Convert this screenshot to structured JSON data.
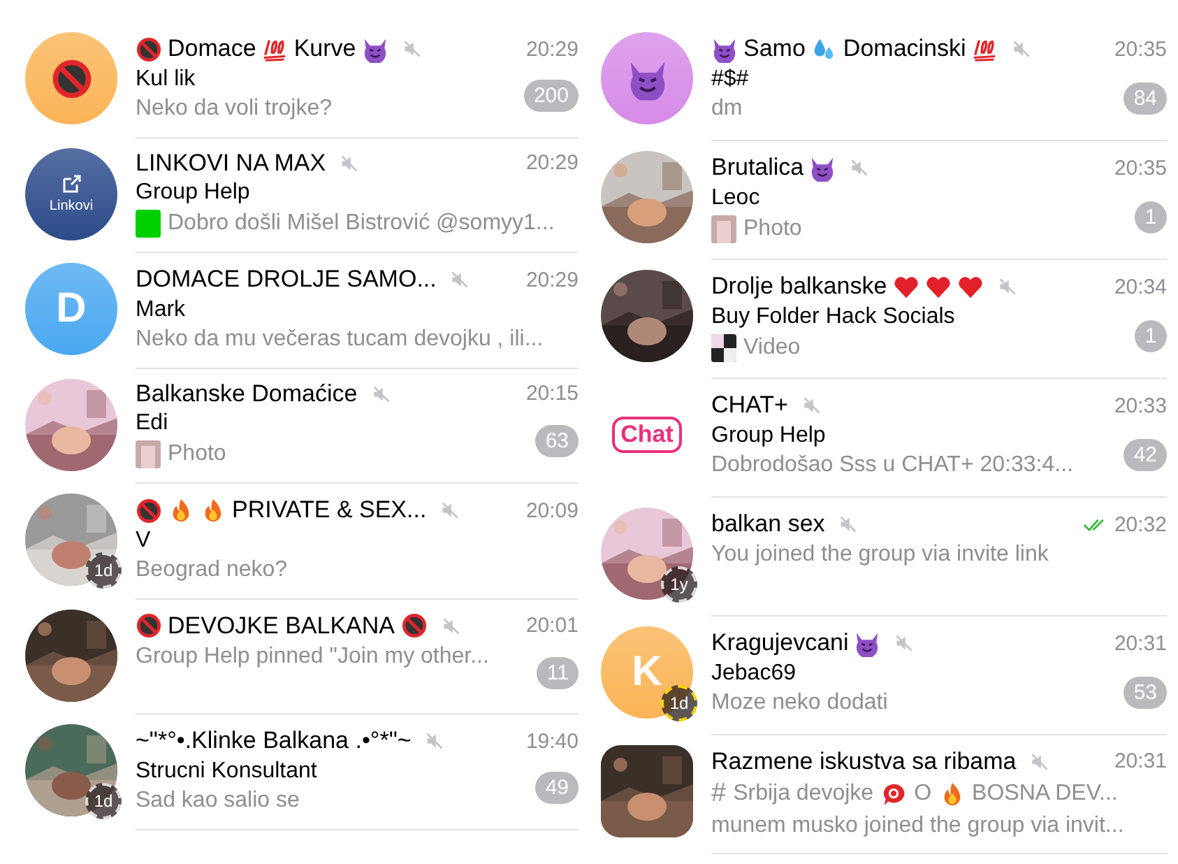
{
  "columns": [
    {
      "chats": [
        {
          "title": [
            {
              "kind": "no18"
            },
            {
              "kind": "text",
              "text": "Domace"
            },
            {
              "kind": "hundred"
            },
            {
              "kind": "text",
              "text": "Kurve"
            },
            {
              "kind": "devil"
            }
          ],
          "muted": true,
          "time": "20:29",
          "sender": "Kul lik",
          "preview": {
            "kind": "text",
            "text": "Neko da voli trojke?"
          },
          "unread": "200",
          "avatar": {
            "kind": "no18",
            "color": "#fbb456"
          }
        },
        {
          "title": [
            {
              "kind": "text",
              "text": "LINKOVI NA MAX"
            }
          ],
          "muted": true,
          "time": "20:29",
          "sender": "Group Help",
          "preview": {
            "kind": "square",
            "color": "#00d000",
            "text": "Dobro došli Mišel Bistrović @somyy1..."
          },
          "avatar": {
            "kind": "link",
            "label": "Linkovi"
          }
        },
        {
          "title": [
            {
              "kind": "text",
              "text": "DOMACE DROLJE SAMO..."
            }
          ],
          "muted": true,
          "time": "20:29",
          "sender": "Mark",
          "preview": {
            "kind": "text",
            "text": "Neko da mu večeras tucam devojku , ili..."
          },
          "avatar": {
            "kind": "letter",
            "letter": "D",
            "color": "#4aa8f0"
          }
        },
        {
          "title": [
            {
              "kind": "text",
              "text": "Balkanske Domaćice"
            }
          ],
          "muted": true,
          "time": "20:15",
          "sender": "Edi",
          "preview": {
            "text": "Photo"
          },
          "unread": "63",
          "avatar": {
            "kind": "picture"
          }
        },
        {
          "title": [
            {
              "kind": "no18"
            },
            {
              "kind": "fire"
            },
            {
              "kind": "fire"
            },
            {
              "kind": "text",
              "text": "PRIVATE & SEX..."
            }
          ],
          "muted": true,
          "time": "20:09",
          "sender": "V",
          "preview": {
            "kind": "text",
            "text": "Beograd neko?"
          },
          "avatar": {
            "kind": "picture"
          },
          "story": {
            "label": "1d",
            "color": "#d8d8d8"
          }
        },
        {
          "title": [
            {
              "kind": "no18"
            },
            {
              "kind": "text",
              "text": "DEVOJKE BALKANA"
            },
            {
              "kind": "no18"
            }
          ],
          "muted": true,
          "time": "20:01",
          "preview": {
            "kind": "text",
            "text": "Group Help pinned \"Join my other..."
          },
          "unread": "11",
          "avatar": {
            "kind": "picture"
          }
        },
        {
          "title": [
            {
              "kind": "text",
              "text": "~\"*°•.Klinke Balkana .•°*\"~"
            }
          ],
          "muted": true,
          "time": "19:40",
          "sender": "Strucni Konsultant",
          "preview": {
            "kind": "text",
            "text": "Sad kao salio se"
          },
          "unread": "49",
          "avatar": {
            "kind": "picture"
          },
          "story": {
            "label": "1d",
            "color": "#d8d8d8"
          }
        }
      ]
    },
    {
      "chats": [
        {
          "title": [
            {
              "kind": "devil"
            },
            {
              "kind": "text",
              "text": "Samo"
            },
            {
              "kind": "droplets"
            },
            {
              "kind": "text",
              "text": "Domacinski"
            },
            {
              "kind": "hundred"
            }
          ],
          "muted": true,
          "time": "20:35",
          "sender": "#$#",
          "preview": {
            "kind": "text",
            "text": "dm"
          },
          "unread": "84",
          "avatar": {
            "kind": "devil",
            "color": "#d68be8"
          }
        },
        {
          "title": [
            {
              "kind": "text",
              "text": "Brutalica"
            },
            {
              "kind": "devil"
            }
          ],
          "muted": true,
          "time": "20:35",
          "sender": "Leoc",
          "preview": {
            "text": "Photo"
          },
          "unread": "1",
          "avatar": {
            "kind": "picture"
          }
        },
        {
          "title": [
            {
              "kind": "text",
              "text": "Drolje balkanske"
            },
            {
              "kind": "heart"
            },
            {
              "kind": "heart"
            },
            {
              "kind": "heart"
            }
          ],
          "muted": true,
          "time": "20:34",
          "sender": "Buy Folder Hack Socials",
          "preview": {
            "kind": "video",
            "text": "Video"
          },
          "unread": "1",
          "avatar": {
            "kind": "picture"
          }
        },
        {
          "title": [
            {
              "kind": "text",
              "text": "CHAT+"
            }
          ],
          "muted": true,
          "time": "20:33",
          "sender": "Group Help",
          "preview": {
            "kind": "text",
            "text": "Dobrodošao Sss u CHAT+ 20:33:4..."
          },
          "unread": "42",
          "avatar": {
            "kind": "chat",
            "label": "Chat"
          }
        },
        {
          "title": [
            {
              "kind": "text",
              "text": "balkan sex"
            }
          ],
          "muted": true,
          "read": true,
          "time": "20:32",
          "preview": {
            "kind": "text",
            "text": "You joined the group via invite link"
          },
          "avatar": {
            "kind": "picture"
          },
          "story": {
            "label": "1y",
            "color": "#d8d8d8"
          }
        },
        {
          "title": [
            {
              "kind": "text",
              "text": "Kragujevcani"
            },
            {
              "kind": "devil"
            }
          ],
          "muted": true,
          "time": "20:31",
          "sender": "Jebac69",
          "preview": {
            "kind": "text",
            "text": "Moze neko dodati"
          },
          "unread": "53",
          "avatar": {
            "kind": "letter",
            "letter": "K",
            "color": "#fbb456"
          },
          "story": {
            "label": "1d",
            "color": "#f5d000"
          }
        },
        {
          "title": [
            {
              "kind": "text",
              "text": "Razmene iskustva sa ribama"
            }
          ],
          "muted": true,
          "time": "20:31",
          "topic": [
            {
              "kind": "hash",
              "text": "#"
            },
            {
              "kind": "text",
              "text": "Srbija devojke"
            },
            {
              "kind": "bubble"
            },
            {
              "kind": "text",
              "text": "O"
            },
            {
              "kind": "fire"
            },
            {
              "kind": "text",
              "text": "BOSNA DEV..."
            }
          ],
          "preview": {
            "kind": "text",
            "text": "munem musko joined the group via invit..."
          },
          "avatar": {
            "kind": "forum-picture"
          }
        }
      ]
    }
  ]
}
